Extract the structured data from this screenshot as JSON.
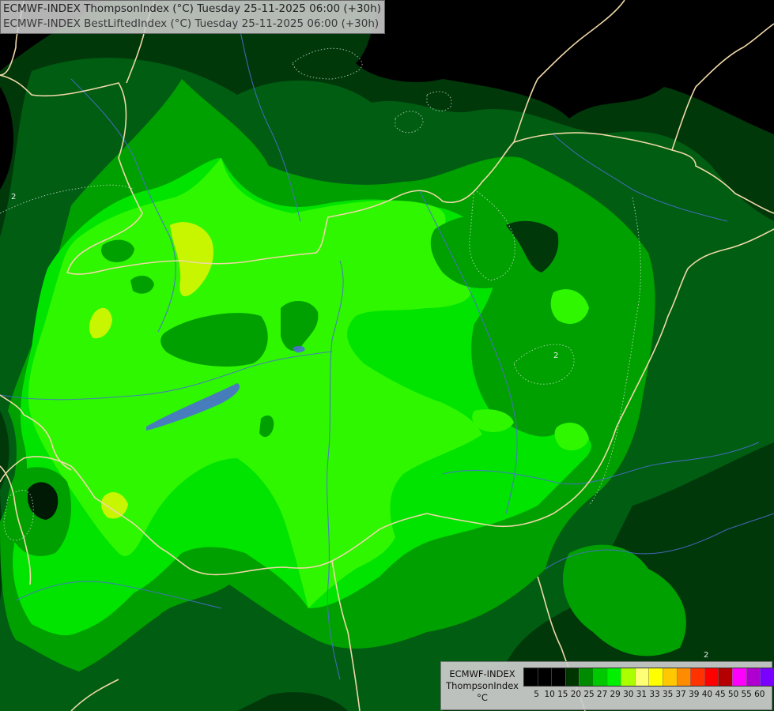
{
  "header": {
    "line1": "ECMWF-INDEX ThompsonIndex (°C) Tuesday 25-11-2025 06:00 (+30h)",
    "line2": "ECMWF-INDEX BestLiftedIndex (°C) Tuesday 25-11-2025 06:00 (+30h)"
  },
  "contour_labels": [
    "2",
    "2",
    "2"
  ],
  "legend": {
    "source": "ECMWF-INDEX",
    "parameter": "ThompsonIndex",
    "unit": "°C",
    "colors": [
      "#000000",
      "#000000",
      "#000000",
      "#003500",
      "#008a00",
      "#00c800",
      "#00f000",
      "#aaff00",
      "#ffff77",
      "#ffff00",
      "#ffc800",
      "#ff8c00",
      "#ff3200",
      "#ff0000",
      "#b40000",
      "#ff00ff",
      "#b000d0",
      "#7a00ff",
      "#0000ff"
    ],
    "ticks": [
      "5",
      "10",
      "15",
      "20",
      "25",
      "27",
      "29",
      "30",
      "31",
      "33",
      "35",
      "37",
      "39",
      "40",
      "45",
      "50",
      "55",
      "60"
    ]
  },
  "palette": {
    "dark": "#00380a",
    "mid_dark": "#005d12",
    "mid": "#00a000",
    "bright": "#00e400",
    "brightest": "#2ef700",
    "yellow_green": "#c8f500",
    "border": "#f0d8a8",
    "river": "#4a6fd0"
  }
}
